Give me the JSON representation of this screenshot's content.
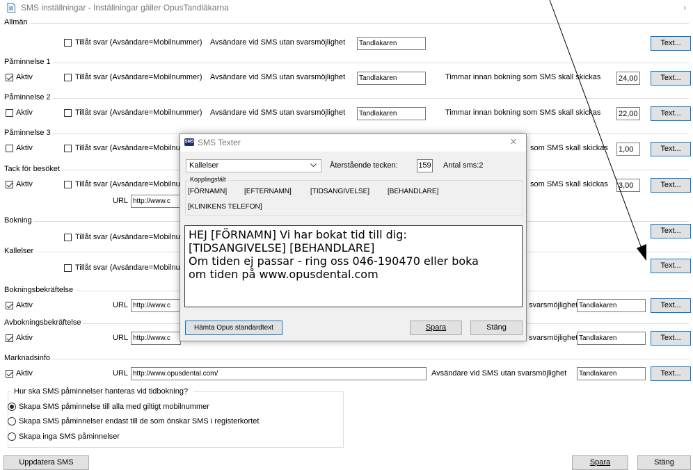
{
  "window": {
    "title": "SMS inställningar - Inställningar gäller OpusTandläkarna"
  },
  "labels": {
    "allow_reply": "Tillåt svar (Avsändare=Mobilnummer)",
    "allow_reply_trunc": "Tillåt svar (Avsändare=Mobilnu",
    "sender_no_reply": "Avsändare vid SMS utan svarsmöjlighet",
    "sender_trunc": "svarsmöjlighet",
    "hours_before": "Timmar innan bokning som SMS skall skickas",
    "hours_trunc": "som SMS skall skickas",
    "active": "Aktiv",
    "url": "URL",
    "text_button": "Text..."
  },
  "groups": {
    "allman": {
      "title": "Allmän",
      "sender_value": "Tandlakaren"
    },
    "paminnelse1": {
      "title": "Påminnelse 1",
      "sender_value": "Tandlakaren",
      "hours": "24,00"
    },
    "paminnelse2": {
      "title": "Påminnelse 2",
      "sender_value": "Tandlakaren",
      "hours": "22,00"
    },
    "paminnelse3": {
      "title": "Påminnelse 3",
      "hours": "1,00"
    },
    "tack": {
      "title": "Tack för besöket",
      "url": "http://www.c",
      "hours": "3,00"
    },
    "bokning": {
      "title": "Bokning"
    },
    "kallelser": {
      "title": "Kallelser"
    },
    "bokningsbekraftelse": {
      "title": "Bokningsbekräftelse",
      "url": "http://www.c",
      "sender_value": "Tandlakaren"
    },
    "avbokningsbekraftelse": {
      "title": "Avbokningsbekräftelse",
      "url": "http://www.c",
      "sender_value": "Tandlakaren"
    },
    "marknadsinfo": {
      "title": "Marknadsinfo",
      "url": "http://www.opusdental.com/",
      "sender_value": "Tandlakaren"
    }
  },
  "reminder_handling": {
    "question": "Hur ska SMS påminnelser hanteras vid tidbokning?",
    "options": [
      "Skapa SMS påminnelse till alla med giltigt mobilnummer",
      "Skapa SMS påminnelser endast till de som önskar SMS i registerkortet",
      "Skapa inga SMS påminnelser"
    ],
    "selected_index": 0
  },
  "footer": {
    "update_label": "Uppdatera SMS",
    "save_label": "Spara",
    "close_label": "Stäng"
  },
  "dialog": {
    "title": "SMS Texter",
    "app_badge": "SMS",
    "dropdown_value": "Kallelser",
    "remaining_label": "Återstående tecken:",
    "remaining_value": "159",
    "sms_count": "Antal sms:2",
    "fields_title": "Kopplingsfält",
    "fields": [
      "[FÖRNAMN]",
      "[EFTERNAMN]",
      "[TIDSANGIVELSE]",
      "[BEHANDLARE]",
      "[KLINIKENS TELEFON]"
    ],
    "message": "HEJ [FÖRNAMN] Vi har bokat tid till dig:\n[TIDSANGIVELSE] [BEHANDLARE]\nOm tiden ej passar - ring oss 046-190470 eller boka\nom tiden på www.opusdental.com",
    "fetch_label": "Hämta Opus standardtext",
    "save_label": "Spara",
    "close_label": "Stäng"
  }
}
